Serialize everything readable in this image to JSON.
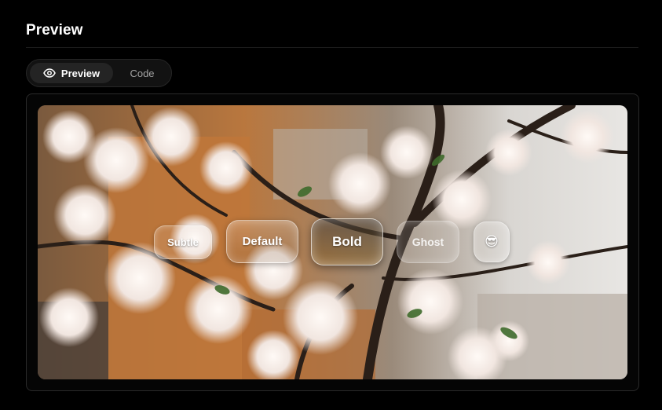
{
  "header": {
    "title": "Preview"
  },
  "tabs": [
    {
      "label": "Preview",
      "icon": "eye-icon",
      "active": true
    },
    {
      "label": "Code",
      "active": false
    }
  ],
  "preview": {
    "background_image": "cherry-blossom-photo",
    "buttons": [
      {
        "label": "Subtle",
        "variant": "subtle"
      },
      {
        "label": "Default",
        "variant": "default"
      },
      {
        "label": "Bold",
        "variant": "bold"
      },
      {
        "label": "Ghost",
        "variant": "ghost"
      },
      {
        "label": "😎",
        "variant": "emoji"
      }
    ]
  },
  "colors": {
    "background": "#000000",
    "frame_border": "#2a2a2a",
    "tab_active": "#242424",
    "tab_inactive_text": "#a3a3a3"
  }
}
